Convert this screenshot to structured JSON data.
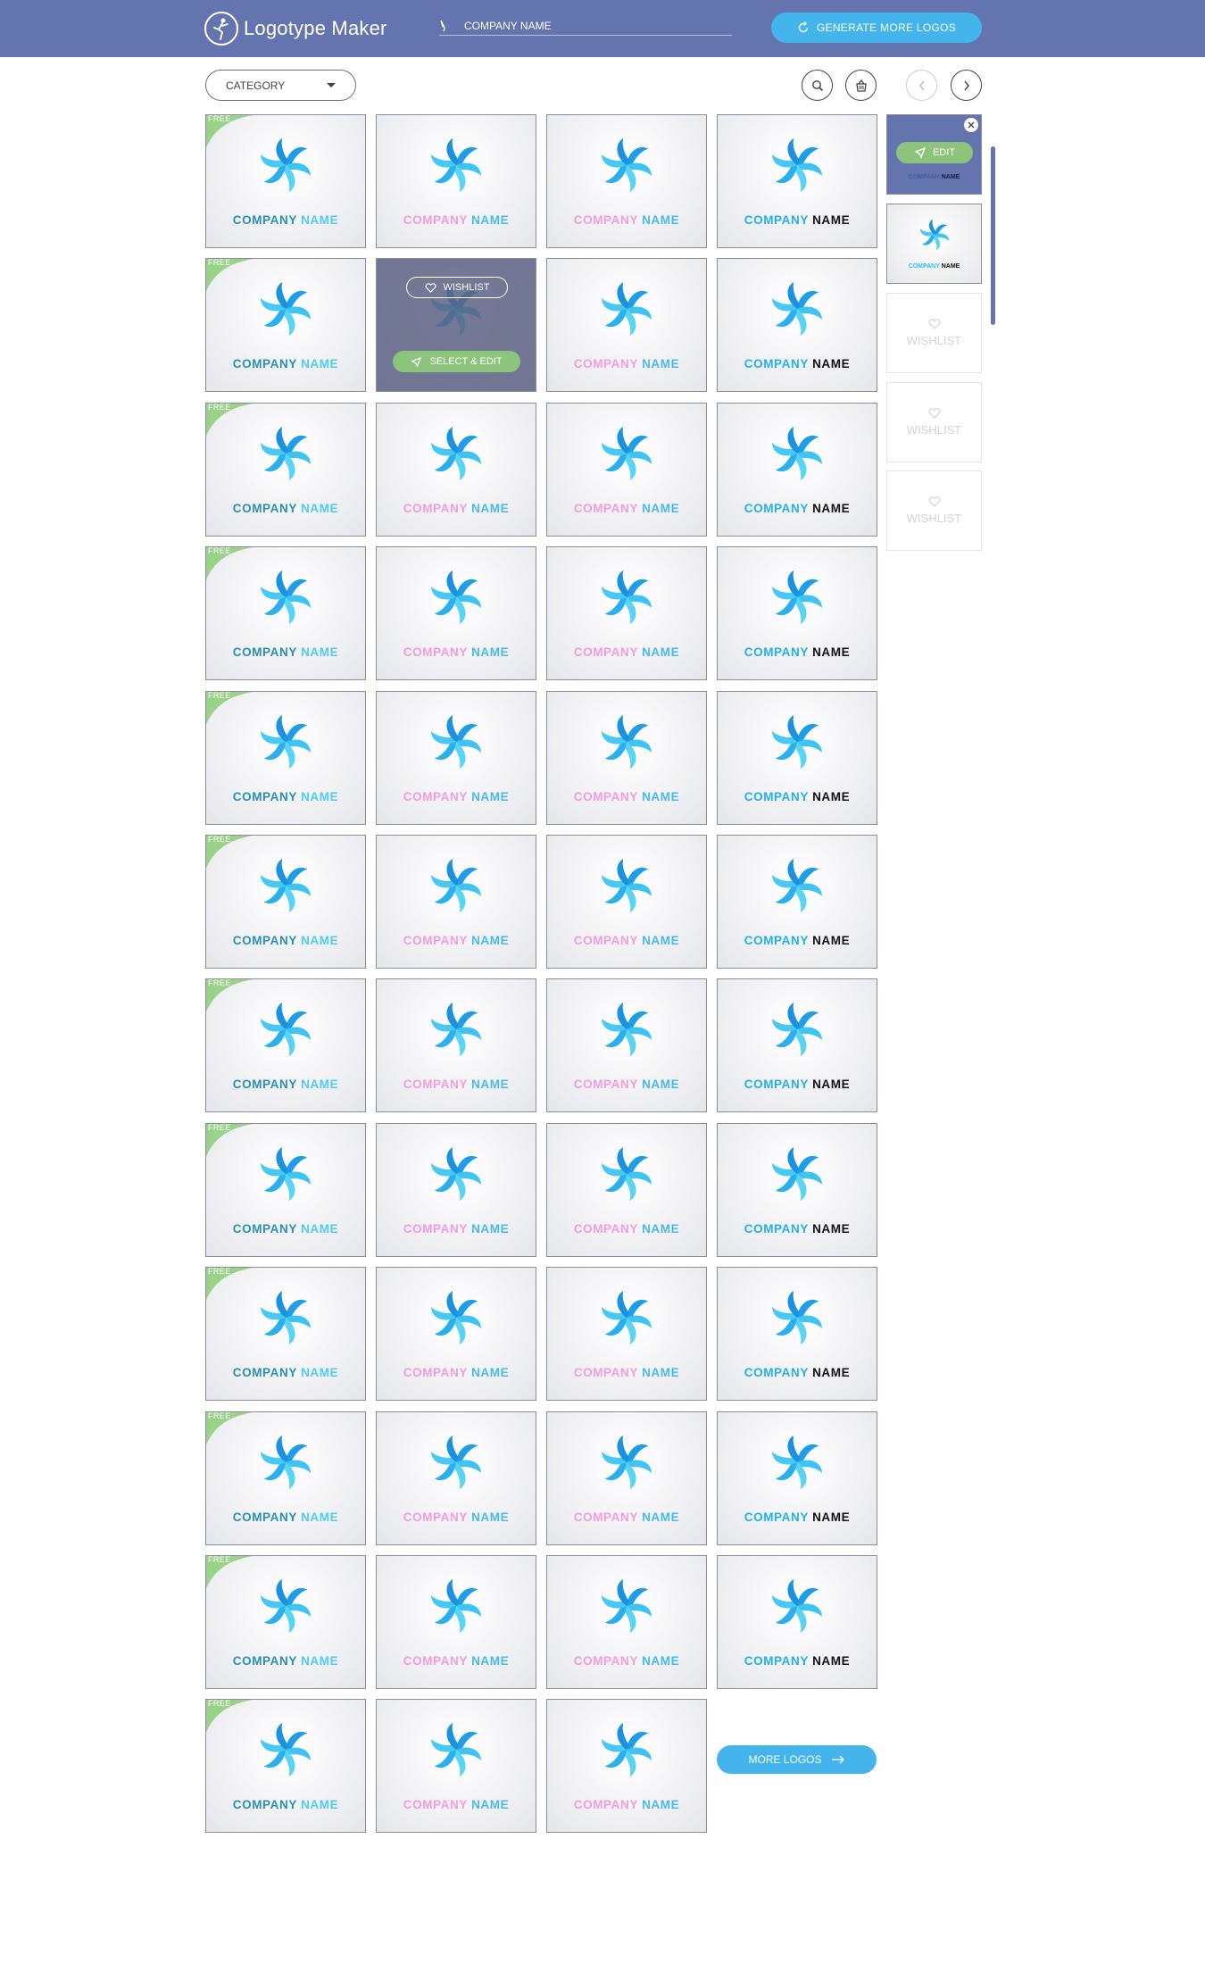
{
  "header": {
    "brand": "Logotype Maker",
    "name_placeholder": "COMPANY NAME",
    "generate_label": "GENERATE MORE LOGOS"
  },
  "toolbar": {
    "category_label": "CATEGORY"
  },
  "logo_text": {
    "word1": "COMPANY",
    "word2": "NAME"
  },
  "free_label": "FREE",
  "hover": {
    "wishlist_label": "WISHLIST",
    "select_label": "SELECT & EDIT"
  },
  "more_label": "MORE LOGOS",
  "sidebar": {
    "edit_label": "EDIT",
    "wishlist_label": "WISHLIST",
    "mini_word1": "COMPANY",
    "mini_word2": "NAME"
  },
  "colors": {
    "header_bg": "#6374ae",
    "accent_blue": "#43b4ec",
    "accent_green": "#8bc47a",
    "logo_blue": "#2fc0ee"
  },
  "grid": {
    "columns": 4,
    "rows": 12,
    "last_row_tiles": 3,
    "hover_tile": {
      "row": 1,
      "col": 1
    },
    "column_styles": [
      "v1",
      "v2",
      "v2",
      "v3"
    ],
    "free_column": 0
  }
}
